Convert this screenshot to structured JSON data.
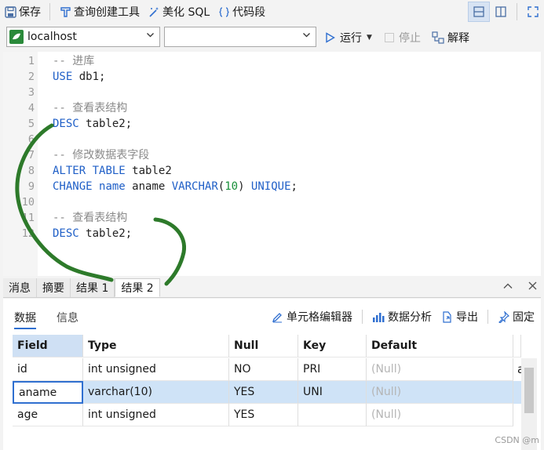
{
  "toolbar": {
    "save_label": "保存",
    "query_builder_label": "查询创建工具",
    "beautify_label": "美化 SQL",
    "snippet_label": "代码段"
  },
  "connection": {
    "server": "localhost",
    "database": "",
    "run_label": "运行",
    "stop_label": "停止",
    "explain_label": "解释"
  },
  "editor": {
    "line_numbers": [
      "1",
      "2",
      "3",
      "4",
      "5",
      "6",
      "7",
      "8",
      "9",
      "10",
      "11",
      "12"
    ],
    "lines": [
      {
        "parts": [
          {
            "t": "-- 进库",
            "c": "cm"
          }
        ]
      },
      {
        "parts": [
          {
            "t": "USE",
            "c": "kw"
          },
          {
            "t": " db1;",
            "c": ""
          }
        ]
      },
      {
        "parts": []
      },
      {
        "parts": [
          {
            "t": "-- 查看表结构",
            "c": "cm"
          }
        ]
      },
      {
        "parts": [
          {
            "t": "DESC",
            "c": "kw"
          },
          {
            "t": " table2;",
            "c": ""
          }
        ]
      },
      {
        "parts": []
      },
      {
        "parts": [
          {
            "t": "-- 修改数据表字段",
            "c": "cm"
          }
        ]
      },
      {
        "parts": [
          {
            "t": "ALTER",
            "c": "kw"
          },
          {
            "t": " ",
            "c": ""
          },
          {
            "t": "TABLE",
            "c": "kw"
          },
          {
            "t": " table2",
            "c": ""
          }
        ]
      },
      {
        "parts": [
          {
            "t": "CHANGE",
            "c": "kw"
          },
          {
            "t": " ",
            "c": ""
          },
          {
            "t": "name",
            "c": "kw"
          },
          {
            "t": " aname ",
            "c": ""
          },
          {
            "t": "VARCHAR",
            "c": "kw"
          },
          {
            "t": "(",
            "c": ""
          },
          {
            "t": "10",
            "c": "num"
          },
          {
            "t": ") ",
            "c": ""
          },
          {
            "t": "UNIQUE",
            "c": "kw"
          },
          {
            "t": ";",
            "c": ""
          }
        ]
      },
      {
        "parts": []
      },
      {
        "parts": [
          {
            "t": "-- 查看表结构",
            "c": "cm"
          }
        ]
      },
      {
        "parts": [
          {
            "t": "DESC",
            "c": "kw"
          },
          {
            "t": " table2;",
            "c": ""
          }
        ]
      }
    ]
  },
  "result_tabs": [
    "消息",
    "摘要",
    "结果 1",
    "结果 2"
  ],
  "result_subtabs": [
    "数据",
    "信息"
  ],
  "result_actions": {
    "cell_editor": "单元格编辑器",
    "data_analysis": "数据分析",
    "export": "导出",
    "pin": "固定"
  },
  "grid": {
    "columns": [
      "Field",
      "Type",
      "Null",
      "Key",
      "Default"
    ],
    "rows": [
      [
        "id",
        "int unsigned",
        "NO",
        "PRI",
        "(Null)"
      ],
      [
        "aname",
        "varchar(10)",
        "YES",
        "UNI",
        "(Null)"
      ],
      [
        "age",
        "int unsigned",
        "YES",
        "",
        "(Null)"
      ]
    ],
    "overflow_text": "a"
  },
  "watermark": "CSDN @m",
  "colors": {
    "accent": "#2f6fd0",
    "keyword": "#1f5fc7",
    "comment": "#8a8a8a",
    "number": "#19903a",
    "annotation": "#2d7a2a"
  }
}
